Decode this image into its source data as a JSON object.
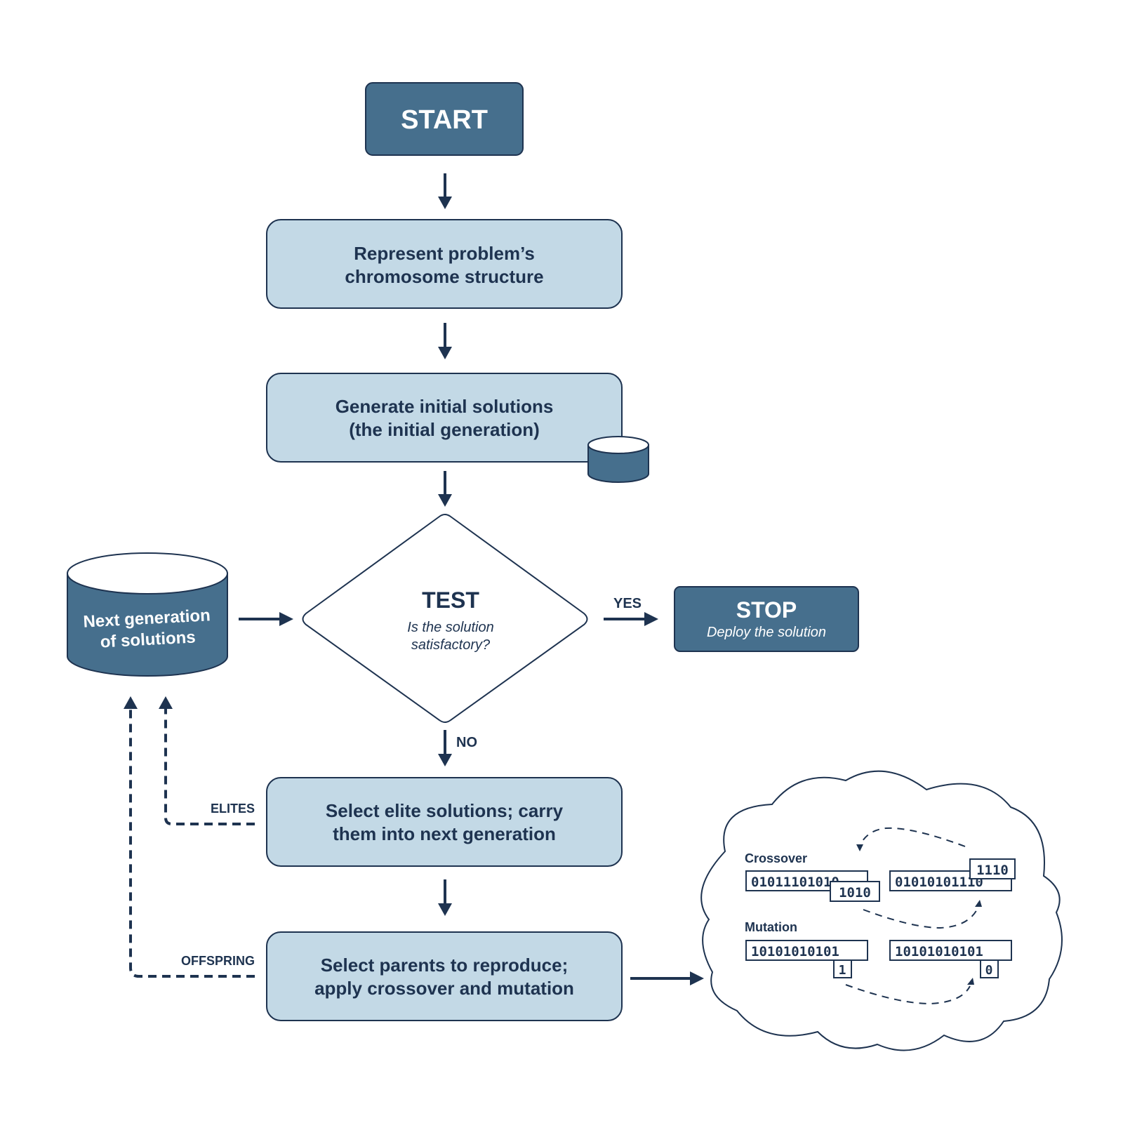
{
  "colors": {
    "dark_box": "#466f8d",
    "light_box": "#c3d9e6",
    "stroke": "#1e3350",
    "text": "#1e3350",
    "white": "#ffffff"
  },
  "start": {
    "label": "START"
  },
  "step_represent": {
    "line1": "Represent problem’s",
    "line2": "chromosome structure"
  },
  "step_generate": {
    "line1": "Generate initial solutions",
    "line2": "(the initial generation)"
  },
  "test": {
    "title": "TEST",
    "question_line1": "Is the solution",
    "question_line2": "satisfactory?"
  },
  "yes_label": "YES",
  "no_label": "NO",
  "stop": {
    "title": "STOP",
    "subtitle": "Deploy the solution"
  },
  "next_gen": {
    "line1": "Next generation",
    "line2": "of solutions"
  },
  "step_elite": {
    "line1": "Select elite solutions; carry",
    "line2": "them into next generation"
  },
  "step_parents": {
    "line1": "Select parents to reproduce;",
    "line2": "apply crossover and mutation"
  },
  "elites_label": "ELITES",
  "offspring_label": "OFFSPRING",
  "cloud": {
    "crossover": {
      "title": "Crossover",
      "chrom_a": "01011101010",
      "chrom_a_segment": "1010",
      "chrom_b": "01010101110",
      "chrom_b_segment": "1110"
    },
    "mutation": {
      "title": "Mutation",
      "chrom_a": "10101010101",
      "chrom_a_bit": "1",
      "chrom_b": "10101010101",
      "chrom_b_bit": "0"
    }
  }
}
